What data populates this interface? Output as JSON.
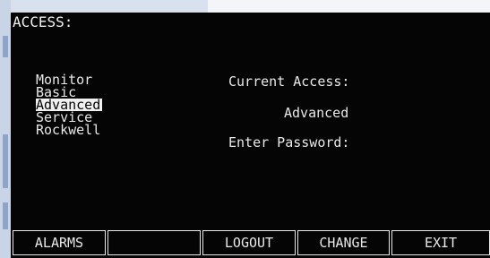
{
  "screen": {
    "title": "ACCESS:"
  },
  "access_levels": [
    {
      "label": "Monitor",
      "selected": false
    },
    {
      "label": "Basic",
      "selected": false
    },
    {
      "label": "Advanced",
      "selected": true
    },
    {
      "label": "Service",
      "selected": false
    },
    {
      "label": "Rockwell",
      "selected": false
    }
  ],
  "current_access": {
    "label": "Current Access:",
    "value": "Advanced"
  },
  "password": {
    "label": "Enter Password:"
  },
  "softkeys": [
    {
      "label": "ALARMS"
    },
    {
      "label": ""
    },
    {
      "label": "LOGOUT"
    },
    {
      "label": "CHANGE"
    },
    {
      "label": "EXIT"
    }
  ]
}
